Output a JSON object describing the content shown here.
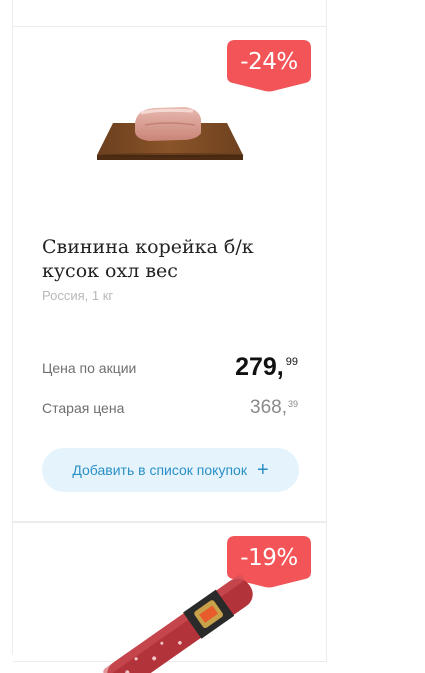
{
  "products": [
    {
      "discount": "-24%",
      "title": "Свинина корейка б/к кусок охл вес",
      "subtitle": "Россия, 1 кг",
      "price_label": "Цена по акции",
      "price_main": "279,",
      "price_cents": "99",
      "old_price_label": "Старая цена",
      "old_price_main": "368,",
      "old_price_cents": "39",
      "add_button_label": "Добавить в список покупок"
    },
    {
      "discount": "-19%"
    }
  ],
  "colors": {
    "badge": "#f25457",
    "button_bg": "#e5f4fc",
    "button_text": "#2b8fc7"
  }
}
